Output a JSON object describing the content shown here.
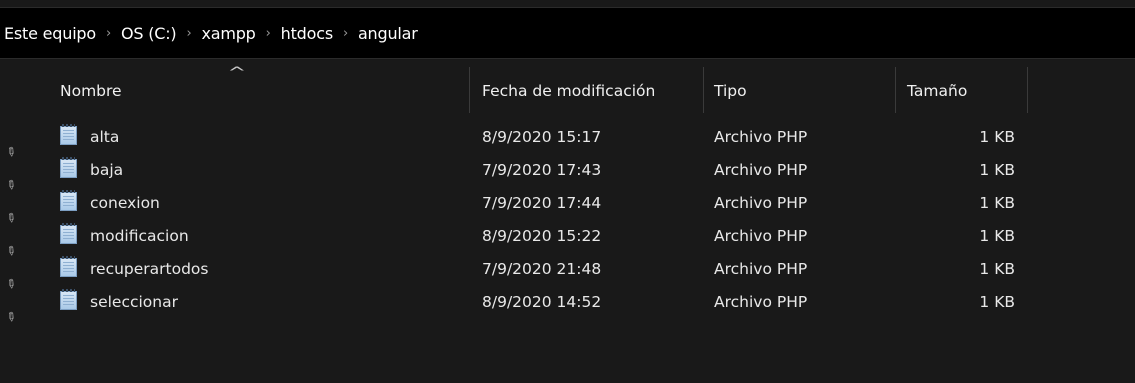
{
  "breadcrumb": {
    "items": [
      "Este equipo",
      "OS (C:)",
      "xampp",
      "htdocs",
      "angular"
    ],
    "separator": "›"
  },
  "columns": {
    "name": "Nombre",
    "date": "Fecha de modificación",
    "type": "Tipo",
    "size": "Tamaño",
    "sort_indicator": "^"
  },
  "files": [
    {
      "name": "alta",
      "date": "8/9/2020 15:17",
      "type": "Archivo PHP",
      "size": "1 KB"
    },
    {
      "name": "baja",
      "date": "7/9/2020 17:43",
      "type": "Archivo PHP",
      "size": "1 KB"
    },
    {
      "name": "conexion",
      "date": "7/9/2020 17:44",
      "type": "Archivo PHP",
      "size": "1 KB"
    },
    {
      "name": "modificacion",
      "date": "8/9/2020 15:22",
      "type": "Archivo PHP",
      "size": "1 KB"
    },
    {
      "name": "recuperartodos",
      "date": "7/9/2020 21:48",
      "type": "Archivo PHP",
      "size": "1 KB"
    },
    {
      "name": "seleccionar",
      "date": "8/9/2020 14:52",
      "type": "Archivo PHP",
      "size": "1 KB"
    }
  ],
  "icons": {
    "file": "php-file-icon",
    "pin": "pin-icon"
  },
  "colors": {
    "background": "#191919",
    "address_bar": "#000000",
    "text": "#ffffff",
    "muted": "#9a9a9a"
  }
}
